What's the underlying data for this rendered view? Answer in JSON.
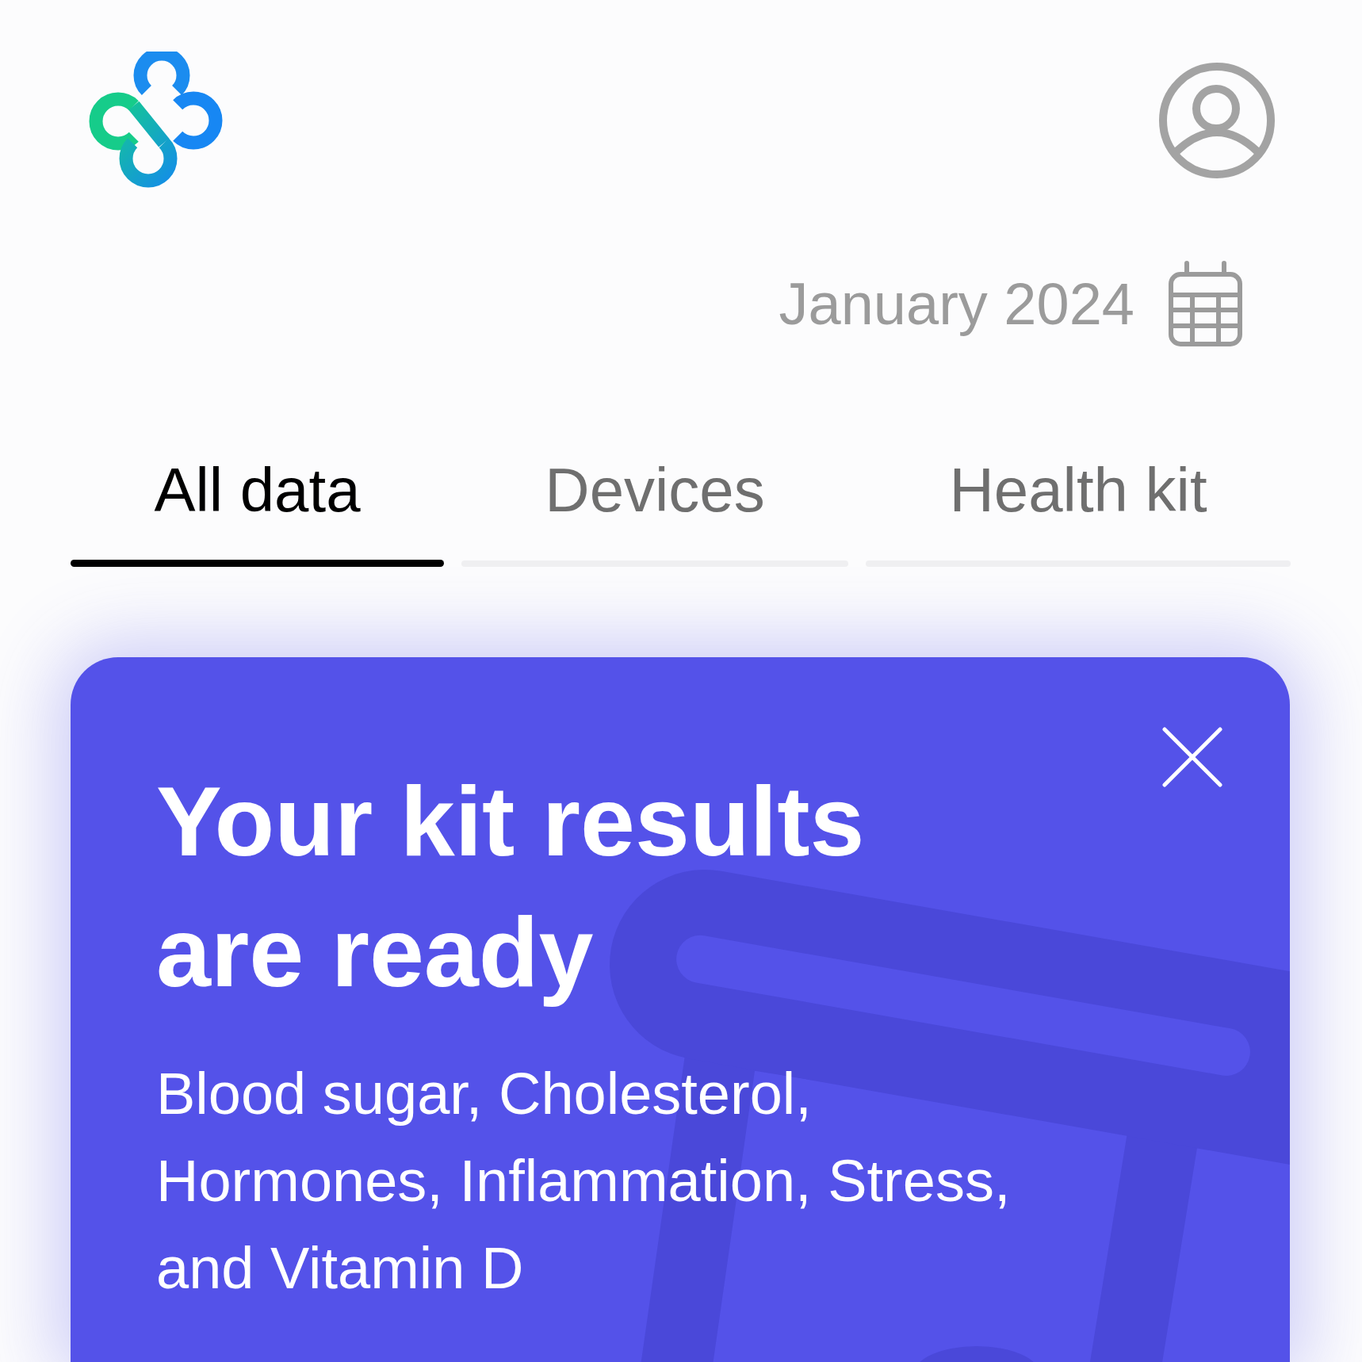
{
  "date_picker": {
    "label": "January 2024"
  },
  "tabs": [
    {
      "label": "All data",
      "selected": true
    },
    {
      "label": "Devices",
      "selected": false
    },
    {
      "label": "Health kit",
      "selected": false
    }
  ],
  "banner": {
    "title": "Your kit results are ready",
    "body": "Blood sugar, Cholesterol, Hormones, Inflammation, Stress, and Vitamin D"
  }
}
